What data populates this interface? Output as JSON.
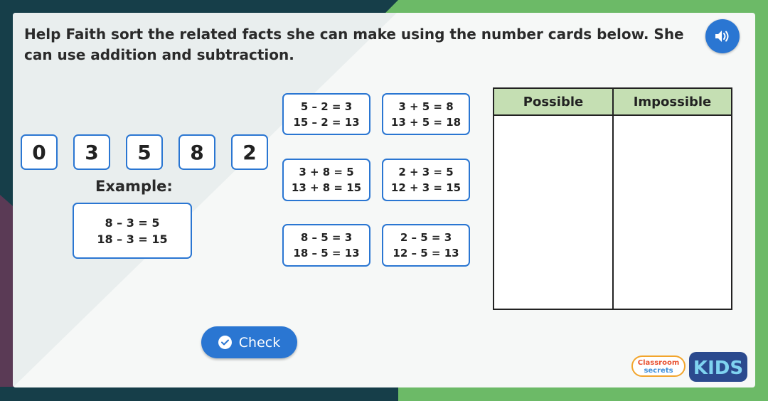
{
  "instructions": "Help Faith sort the related facts she can make using the number cards below. She can use addition and subtraction.",
  "audio_button": {
    "icon": "speaker-icon"
  },
  "number_cards": [
    "0",
    "3",
    "5",
    "8",
    "2"
  ],
  "example": {
    "label": "Example:",
    "lines": [
      "8 – 3 = 5",
      "18 – 3 = 15"
    ]
  },
  "fact_cards": [
    {
      "lines": [
        "5 – 2 = 3",
        "15 – 2 = 13"
      ]
    },
    {
      "lines": [
        "3 + 5 = 8",
        "13 + 5 = 18"
      ]
    },
    {
      "lines": [
        "3 + 8 = 5",
        "13 + 8 = 15"
      ]
    },
    {
      "lines": [
        "2 + 3 = 5",
        "12 + 3 = 15"
      ]
    },
    {
      "lines": [
        "8 – 5 = 3",
        "18 – 5 = 13"
      ]
    },
    {
      "lines": [
        "2 – 5 = 3",
        "12 – 5 = 13"
      ]
    }
  ],
  "table": {
    "headers": [
      "Possible",
      "Impossible"
    ]
  },
  "check_button": {
    "label": "Check",
    "icon": "checkmark-icon"
  },
  "logo": {
    "top_text": "Classroom",
    "bottom_text": "secrets",
    "kids_text": "KIDS"
  },
  "colors": {
    "accent": "#2a76d2",
    "border_green": "#6cba67",
    "table_header": "#c5dfb3",
    "background_dark": "#163e49",
    "background_purple": "#5a3a55"
  }
}
